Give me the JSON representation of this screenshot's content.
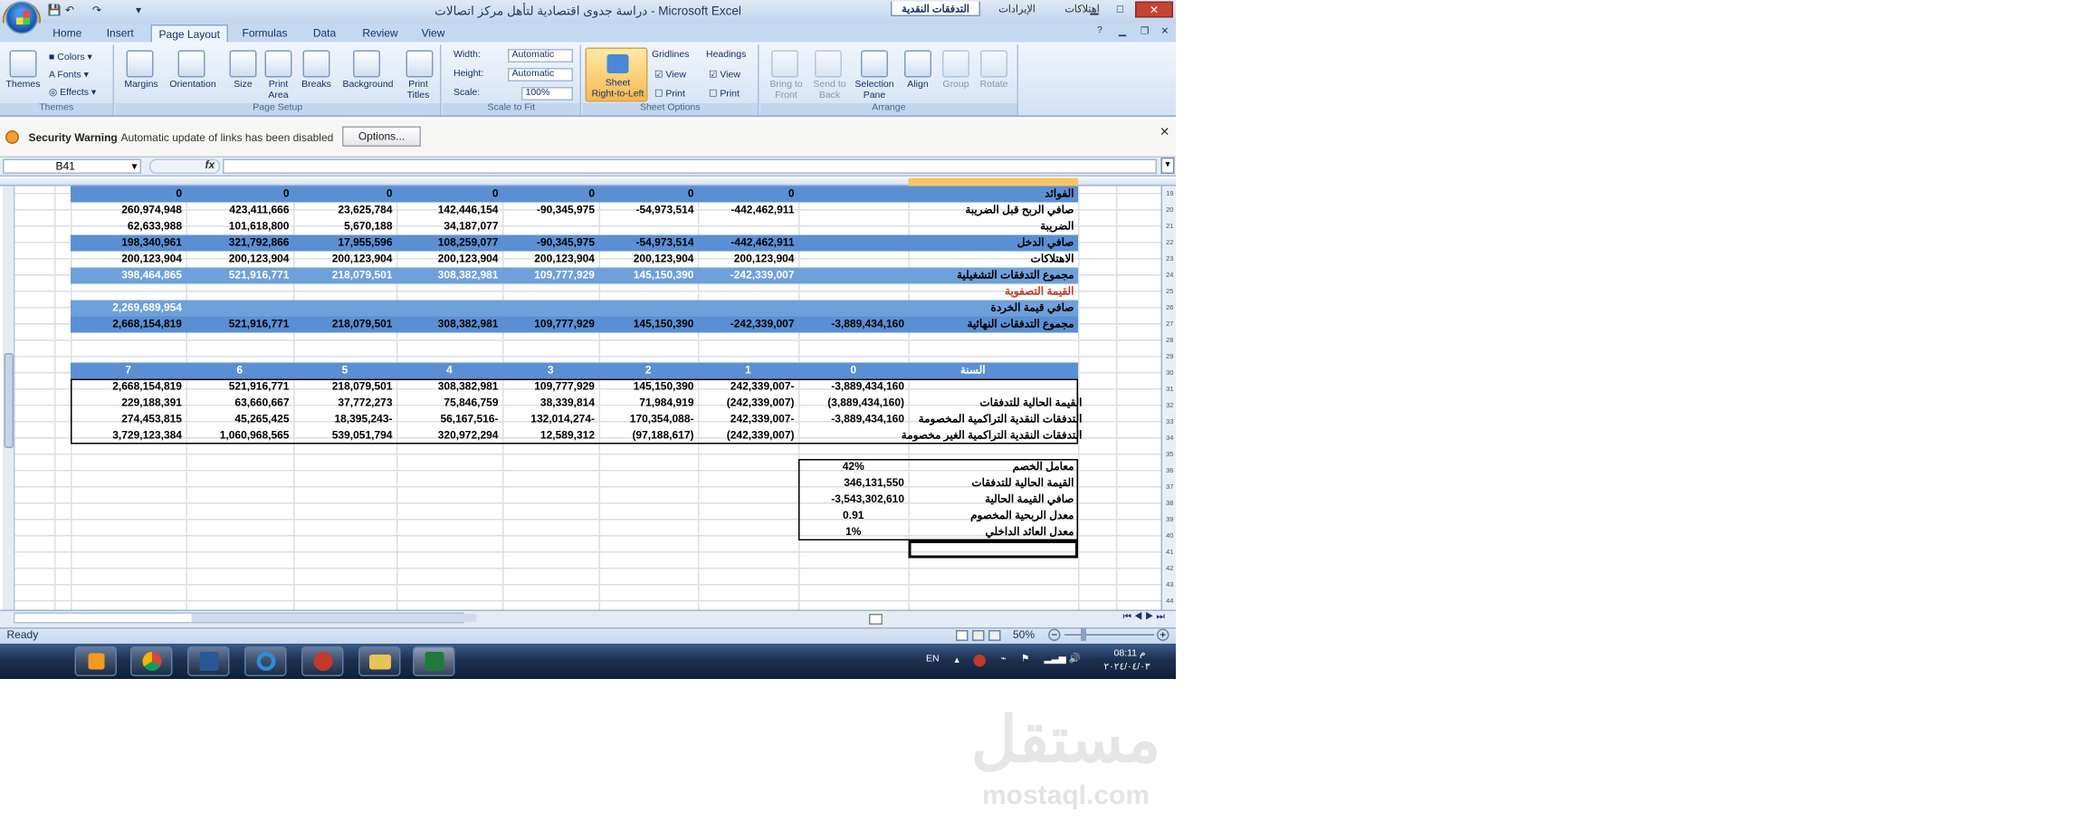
{
  "window": {
    "title": "دراسة جدوى اقتصادية لتأهل مركز اتصالات - Microsoft Excel",
    "min": "▁",
    "max": "□",
    "close": "✕"
  },
  "ribbon_tabs": [
    "Home",
    "Insert",
    "Page Layout",
    "Formulas",
    "Data",
    "Review",
    "View"
  ],
  "themes": {
    "label": "Themes",
    "colors": "Colors",
    "fonts": "Fonts",
    "effects": "Effects",
    "group": "Themes"
  },
  "page_setup": {
    "margins": "Margins",
    "orientation": "Orientation",
    "size": "Size",
    "print_area_1": "Print",
    "print_area_2": "Area",
    "breaks": "Breaks",
    "background": "Background",
    "print_titles_1": "Print",
    "print_titles_2": "Titles",
    "group": "Page Setup"
  },
  "scale_to_fit": {
    "width_label": "Width:",
    "width_value": "Automatic",
    "height_label": "Height:",
    "height_value": "Automatic",
    "scale_label": "Scale:",
    "scale_value": "100%",
    "group": "Scale to Fit"
  },
  "sheet_options": {
    "rtl_1": "Sheet",
    "rtl_2": "Right-to-Left",
    "gridlines": "Gridlines",
    "headings": "Headings",
    "view": "View",
    "print": "Print",
    "group": "Sheet Options"
  },
  "arrange": {
    "bring_1": "Bring to",
    "bring_2": "Front",
    "send_1": "Send to",
    "send_2": "Back",
    "selection_1": "Selection",
    "selection_2": "Pane",
    "align": "Align",
    "group_btn": "Group",
    "rotate": "Rotate",
    "group": "Arrange"
  },
  "security": {
    "title": "Security Warning",
    "message": "Automatic update of links has been disabled",
    "options": "Options..."
  },
  "formula_bar": {
    "name_box": "B41",
    "fx": "fx",
    "formula": ""
  },
  "rows": {
    "top": [
      {
        "label": "الفوائد",
        "values": [
          "",
          "0",
          "0",
          "0",
          "0",
          "0",
          "0",
          "0"
        ],
        "style": "blue-bold"
      },
      {
        "label": "صافي الربح قبل الضريبة",
        "values": [
          "",
          "-442,462,911",
          "-54,973,514",
          "-90,345,975",
          "142,446,154",
          "23,625,784",
          "423,411,666",
          "260,974,948"
        ],
        "style": "white"
      },
      {
        "label": "الضريبة",
        "values": [
          "",
          "",
          "",
          "",
          "34,187,077",
          "5,670,188",
          "101,618,800",
          "62,633,988"
        ],
        "style": "white"
      },
      {
        "label": "صافي الدخل",
        "values": [
          "",
          "-442,462,911",
          "-54,973,514",
          "-90,345,975",
          "108,259,077",
          "17,955,596",
          "321,792,866",
          "198,340,961"
        ],
        "style": "blue"
      },
      {
        "label": "الاهتلاكات",
        "values": [
          "",
          "200,123,904",
          "200,123,904",
          "200,123,904",
          "200,123,904",
          "200,123,904",
          "200,123,904",
          "200,123,904"
        ],
        "style": "white"
      },
      {
        "label": "مجموع التدفقات التشغيلية",
        "values": [
          "",
          "-242,339,007",
          "145,150,390",
          "109,777,929",
          "308,382,981",
          "218,079,501",
          "521,916,771",
          "398,464,865"
        ],
        "style": "blue-light"
      },
      {
        "label": "القيمة التصفوية",
        "values": [
          "",
          "",
          "",
          "",
          "",
          "",
          "",
          ""
        ],
        "style": "red"
      },
      {
        "label": "صافي قيمة الخردة",
        "values": [
          "",
          "",
          "",
          "",
          "",
          "",
          "",
          "2,269,689,954"
        ],
        "style": "blue-light"
      },
      {
        "label": "مجموع التدفقات النهائية",
        "values": [
          "-3,889,434,160",
          "-242,339,007",
          "145,150,390",
          "109,777,929",
          "308,382,981",
          "218,079,501",
          "521,916,771",
          "2,668,154,819"
        ],
        "style": "blue"
      }
    ],
    "year_header": {
      "label": "السنة",
      "values": [
        "0",
        "1",
        "2",
        "3",
        "4",
        "5",
        "6",
        "7"
      ]
    },
    "discount": [
      {
        "label": "",
        "values": [
          "-3,889,434,160",
          "242,339,007-",
          "145,150,390",
          "109,777,929",
          "308,382,981",
          "218,079,501",
          "521,916,771",
          "2,668,154,819"
        ]
      },
      {
        "label": "القيمة الحالية للتدفقات",
        "values": [
          "(3,889,434,160)",
          "(242,339,007)",
          "71,984,919",
          "38,339,814",
          "75,846,759",
          "37,772,273",
          "63,660,667",
          "229,188,391"
        ]
      },
      {
        "label": "التدفقات النقدية التراكمية المخصومة",
        "values": [
          "-3,889,434,160",
          "242,339,007-",
          "170,354,088-",
          "132,014,274-",
          "56,167,516-",
          "18,395,243-",
          "45,265,425",
          "274,453,815"
        ]
      },
      {
        "label": "التدفقات النقدية التراكمية الغير مخصومة",
        "values": [
          "",
          "(242,339,007)",
          "(97,188,617)",
          "12,589,312",
          "320,972,294",
          "539,051,794",
          "1,060,968,565",
          "3,729,123,384"
        ]
      }
    ],
    "summary": [
      {
        "label": "معامل الخصم",
        "value": "42%"
      },
      {
        "label": "القيمة الحالية للتدفقات",
        "value": "346,131,550"
      },
      {
        "label": "صافي القيمة الحالية",
        "value": "-3,543,302,610"
      },
      {
        "label": "معدل الربحية المخصوم",
        "value": "0.91"
      },
      {
        "label": "معدل العائد الداخلي",
        "value": "1%"
      }
    ]
  },
  "row_numbers": [
    "19",
    "20",
    "21",
    "22",
    "23",
    "24",
    "25",
    "26",
    "27",
    "28",
    "29",
    "30",
    "31",
    "32",
    "33",
    "34",
    "35",
    "36",
    "37",
    "38",
    "39",
    "40",
    "41",
    "42",
    "43",
    "44"
  ],
  "sheet_tabs": [
    "التدفقات النقدية",
    "الإيرادات",
    "اهتلاكات"
  ],
  "status": {
    "ready": "Ready",
    "zoom": "50%"
  },
  "taskbar": {
    "lang": "EN",
    "time": "08:11 م",
    "date": "٢٠٢٤/٠٤/٠٣"
  },
  "watermark": {
    "arabic": "مستقل",
    "latin": "mostaql.com"
  },
  "colors": {
    "accent_blue": "#5a8fd4",
    "light_blue": "#6ea0dc",
    "red_text": "#c0392b",
    "sheet_tab_active": "#ffffff"
  }
}
